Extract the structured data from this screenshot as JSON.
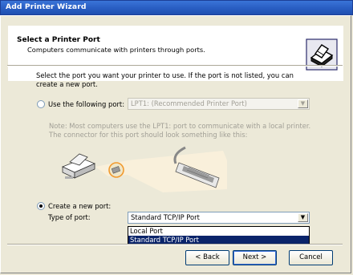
{
  "window": {
    "title": "Add Printer Wizard"
  },
  "header": {
    "title": "Select a Printer Port",
    "subtitle": "Computers communicate with printers through ports."
  },
  "intro_text": "Select the port you want your printer to use.  If the port is not listed, you can create a new port.",
  "option_existing": {
    "label": "Use the following port:",
    "selected": false,
    "combo_value": "LPT1: (Recommended Printer Port)"
  },
  "note_text": "Note: Most computers use the LPT1: port to communicate with a local printer. The connector for this port should look something like this:",
  "option_new": {
    "label": "Create a new port:",
    "selected": true,
    "type_label": "Type of port:",
    "combo_value": "Standard TCP/IP Port",
    "dropdown_options": [
      "Local Port",
      "Standard TCP/IP Port"
    ],
    "highlighted_option": "Standard TCP/IP Port"
  },
  "buttons": {
    "back": "< Back",
    "next": "Next >",
    "cancel": "Cancel"
  },
  "icons": [
    "printer-wizard-icon",
    "printer-icon",
    "parallel-cable-icon",
    "dropdown-arrow-icon"
  ],
  "colors": {
    "title_bar": "#2a5fc4",
    "selection": "#0a246a",
    "dialog_bg": "#ece9d8"
  }
}
